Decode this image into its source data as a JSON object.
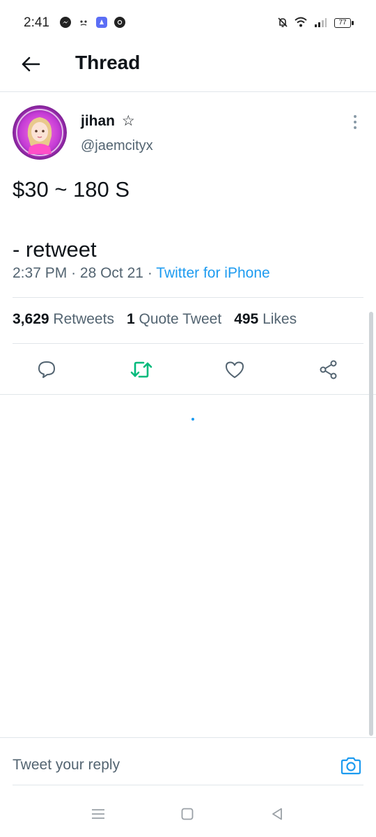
{
  "status_bar": {
    "time": "2:41",
    "battery": "77",
    "icons": [
      "messenger-icon",
      "cat-icon",
      "app-icon",
      "chrome-icon",
      "bell-off-icon",
      "wifi-icon",
      "signal-icon",
      "battery-icon"
    ]
  },
  "header": {
    "title": "Thread"
  },
  "tweet": {
    "author_name": "jihan",
    "name_badge": "☆",
    "author_handle": "@jaemcityx",
    "text": "$30 ~ 180 S\n\n- retweet",
    "time": "2:37 PM",
    "date": "28 Oct 21",
    "separator": "·",
    "source": "Twitter for iPhone"
  },
  "stats": {
    "retweets_count": "3,629",
    "retweets_label": "Retweets",
    "quotes_count": "1",
    "quotes_label": "Quote Tweet",
    "likes_count": "495",
    "likes_label": "Likes"
  },
  "reply": {
    "placeholder": "Tweet your reply"
  },
  "colors": {
    "accent": "#1d9bf0",
    "retweet_green": "#00ba7c",
    "text": "#0f1419",
    "muted": "#536471",
    "divider": "#e1e6ea"
  }
}
